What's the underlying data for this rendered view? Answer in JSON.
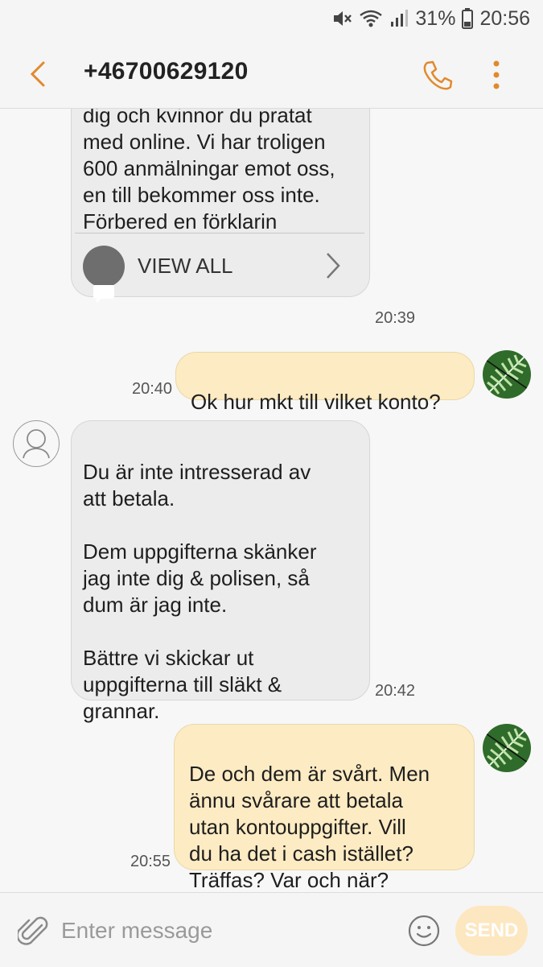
{
  "status_bar": {
    "battery": "31%",
    "time": "20:56",
    "icons": [
      "mute-icon",
      "wifi-icon",
      "signal-icon",
      "battery-icon"
    ]
  },
  "header": {
    "title": "+46700629120",
    "icons": [
      "back-icon",
      "phone-icon",
      "more-vert-icon"
    ]
  },
  "messages": [
    {
      "direction": "incoming",
      "text": "konversationerna mellan\ndig och kvinnor du pratat\nmed online. Vi har troligen\n600 anmälningar emot oss,\nen till bekommer oss inte.\nFörbered en förklarin",
      "view_all_label": "VIEW ALL",
      "time": "20:39"
    },
    {
      "direction": "outgoing",
      "text": "Ok hur mkt till vilket konto?",
      "time": "20:40"
    },
    {
      "direction": "incoming",
      "text": "Du är inte intresserad av\natt betala.\n\nDem uppgifterna skänker\njag inte dig & polisen, så\ndum är jag inte.\n\nBättre vi skickar ut\nuppgifterna till släkt &\ngrannar.",
      "time": "20:42"
    },
    {
      "direction": "outgoing",
      "text": "De och dem är svårt. Men\nännu svårare att betala\nutan kontouppgifter. Vill\ndu ha det i cash istället?\nTräffas? Var och när?",
      "time": "20:55"
    }
  ],
  "composer": {
    "placeholder": "Enter message",
    "send_label": "SEND"
  },
  "colors": {
    "accent": "#e08a2e",
    "incoming_bubble": "#ececec",
    "outgoing_bubble": "#fdebc3",
    "send_button": "#fde7c0"
  }
}
